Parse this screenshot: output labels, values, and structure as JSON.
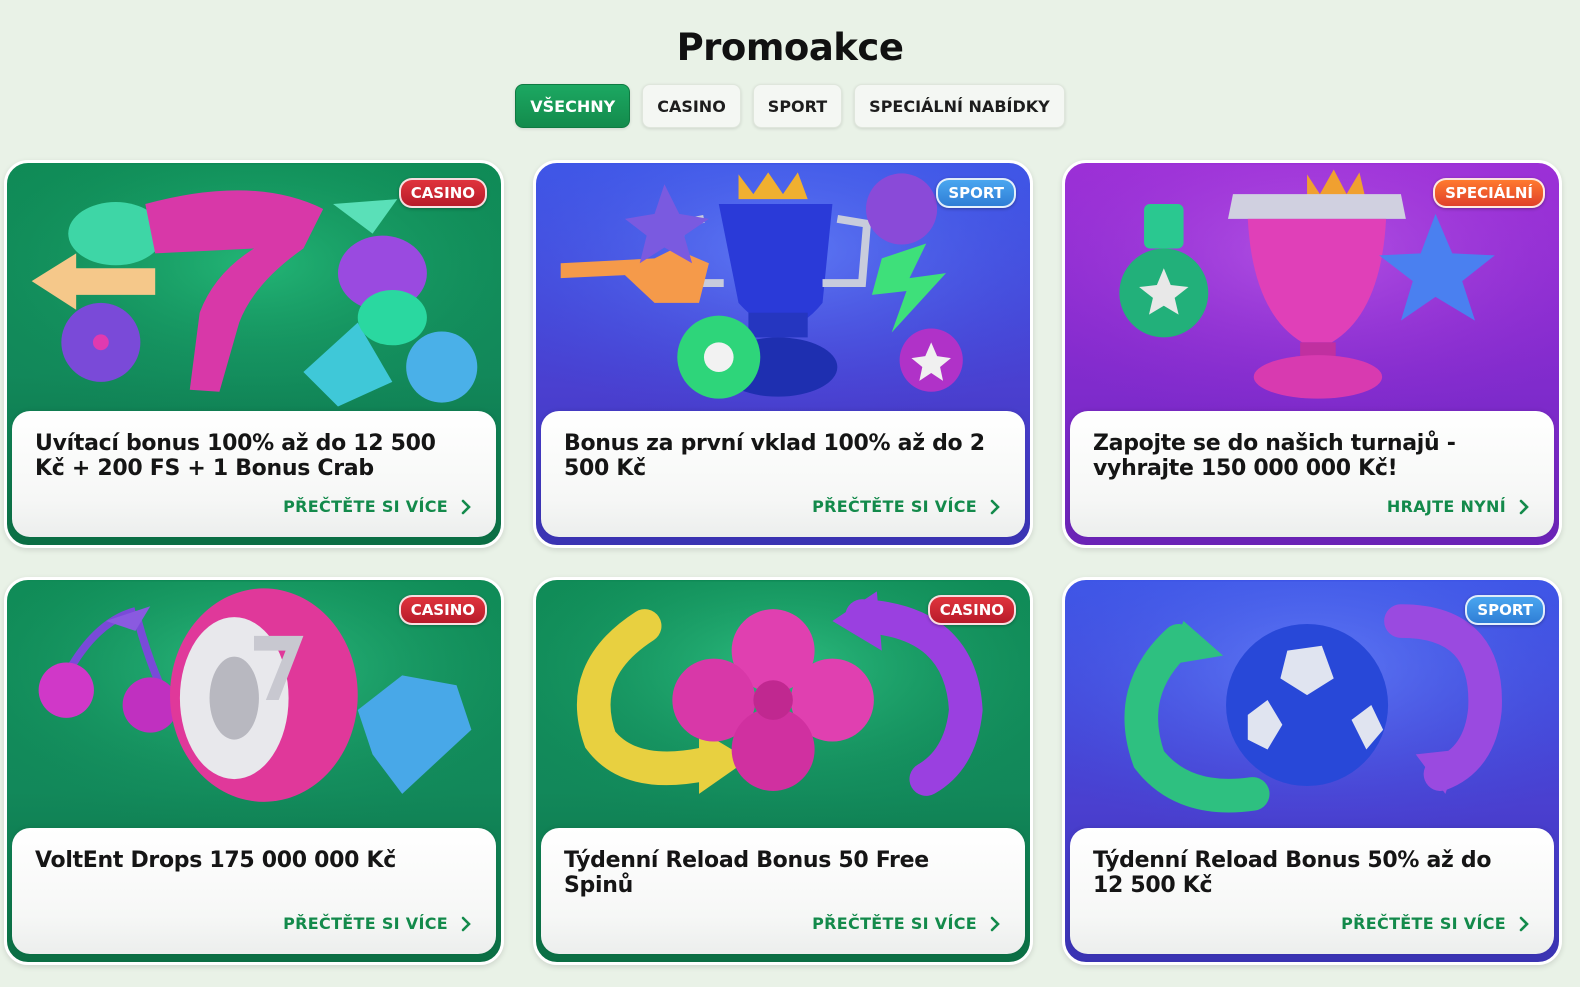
{
  "page": {
    "title": "Promoakce"
  },
  "filters": [
    {
      "label": "VŠECHNY",
      "active": true
    },
    {
      "label": "CASINO",
      "active": false
    },
    {
      "label": "SPORT",
      "active": false
    },
    {
      "label": "SPECIÁLNÍ NABÍDKY",
      "active": false
    }
  ],
  "colors": {
    "accent_green": "#138a4b",
    "page_bg": "#e9f2e7",
    "casino_tag": "#c8222f",
    "sport_tag": "#3a8fe0",
    "special_tag": "#f0562b"
  },
  "promos": [
    {
      "tag": "CASINO",
      "title": "Uvítací bonus 100% až do 12 500 Kč + 200 FS + 1 Bonus Crab",
      "cta": "PŘEČTĚTE SI VÍCE",
      "theme": "green",
      "art": "slot-seven-inflatables"
    },
    {
      "tag": "SPORT",
      "title": "Bonus za první vklad 100% až do 2 500 Kč",
      "cta": "PŘEČTĚTE SI VÍCE",
      "theme": "blue",
      "art": "trophy-inflatables"
    },
    {
      "tag": "SPECIÁLNÍ",
      "title": "Zapojte se do našich turnajů - vyhrajte 150 000 000 Kč!",
      "cta": "HRAJTE NYNÍ",
      "theme": "purple",
      "art": "trophy-medal-star"
    },
    {
      "tag": "CASINO",
      "title": "VoltEnt Drops 175 000 000 Kč",
      "cta": "PŘEČTĚTE SI VÍCE",
      "theme": "green",
      "art": "slot-reel-cherries-diamond"
    },
    {
      "tag": "CASINO",
      "title": "Týdenní Reload Bonus 50 Free Spinů",
      "cta": "PŘEČTĚTE SI VÍCE",
      "theme": "green",
      "art": "clover-arrows"
    },
    {
      "tag": "SPORT",
      "title": "Týdenní Reload Bonus 50% až do 12 500 Kč",
      "cta": "PŘEČTĚTE SI VÍCE",
      "theme": "blue",
      "art": "football-arrows"
    }
  ]
}
